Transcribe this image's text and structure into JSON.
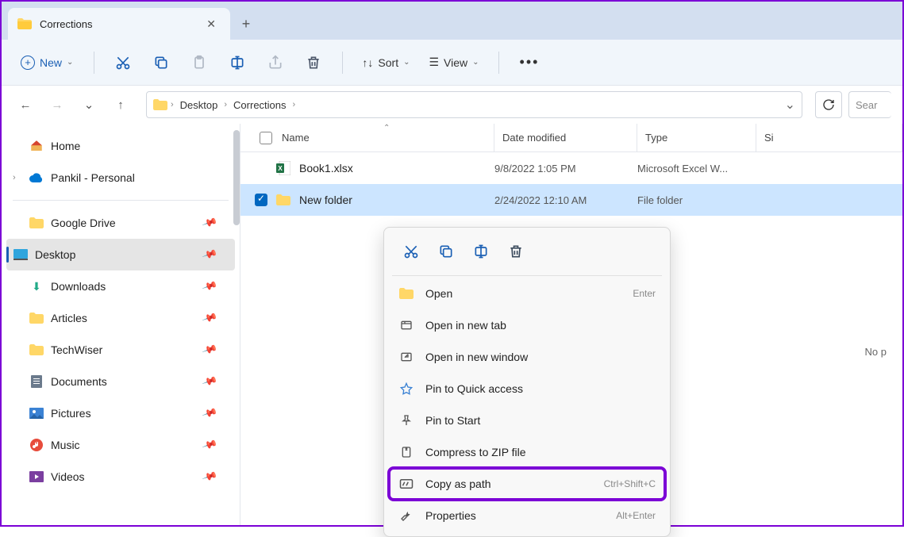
{
  "tab": {
    "title": "Corrections"
  },
  "toolbar": {
    "new_label": "New",
    "sort_label": "Sort",
    "view_label": "View"
  },
  "breadcrumb": [
    "Desktop",
    "Corrections"
  ],
  "search": {
    "placeholder": "Sear"
  },
  "sidebar": {
    "home": "Home",
    "onedrive": "Pankil - Personal",
    "items": [
      {
        "label": "Google Drive"
      },
      {
        "label": "Desktop"
      },
      {
        "label": "Downloads"
      },
      {
        "label": "Articles"
      },
      {
        "label": "TechWiser"
      },
      {
        "label": "Documents"
      },
      {
        "label": "Pictures"
      },
      {
        "label": "Music"
      },
      {
        "label": "Videos"
      }
    ]
  },
  "columns": {
    "name": "Name",
    "date": "Date modified",
    "type": "Type",
    "size": "Si"
  },
  "files": [
    {
      "name": "Book1.xlsx",
      "date": "9/8/2022 1:05 PM",
      "type": "Microsoft Excel W..."
    },
    {
      "name": "New folder",
      "date": "2/24/2022 12:10 AM",
      "type": "File folder"
    }
  ],
  "empty_msg": "No p",
  "context_menu": {
    "open": "Open",
    "open_shortcut": "Enter",
    "open_tab": "Open in new tab",
    "open_window": "Open in new window",
    "pin_quick": "Pin to Quick access",
    "pin_start": "Pin to Start",
    "compress": "Compress to ZIP file",
    "copy_path": "Copy as path",
    "copy_path_shortcut": "Ctrl+Shift+C",
    "properties": "Properties",
    "properties_shortcut": "Alt+Enter"
  }
}
